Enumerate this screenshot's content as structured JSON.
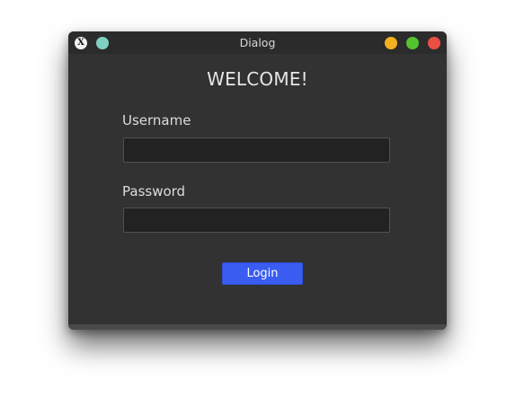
{
  "window": {
    "title": "Dialog",
    "app_icon_glyph": "X",
    "buttons": {
      "pin": {
        "icon": "pin-icon",
        "color": "#7fd1c0"
      },
      "minimize": {
        "icon": "minimize-icon",
        "color": "#f3b01f"
      },
      "maximize": {
        "icon": "maximize-icon",
        "color": "#55c232"
      },
      "close": {
        "icon": "close-icon",
        "color": "#ea4f43"
      }
    }
  },
  "form": {
    "heading": "WELCOME!",
    "username_label": "Username",
    "username_value": "",
    "password_label": "Password",
    "password_value": "",
    "login_label": "Login"
  },
  "colors": {
    "accent": "#3a5cf0",
    "background": "#323232",
    "field_background": "#222222"
  }
}
